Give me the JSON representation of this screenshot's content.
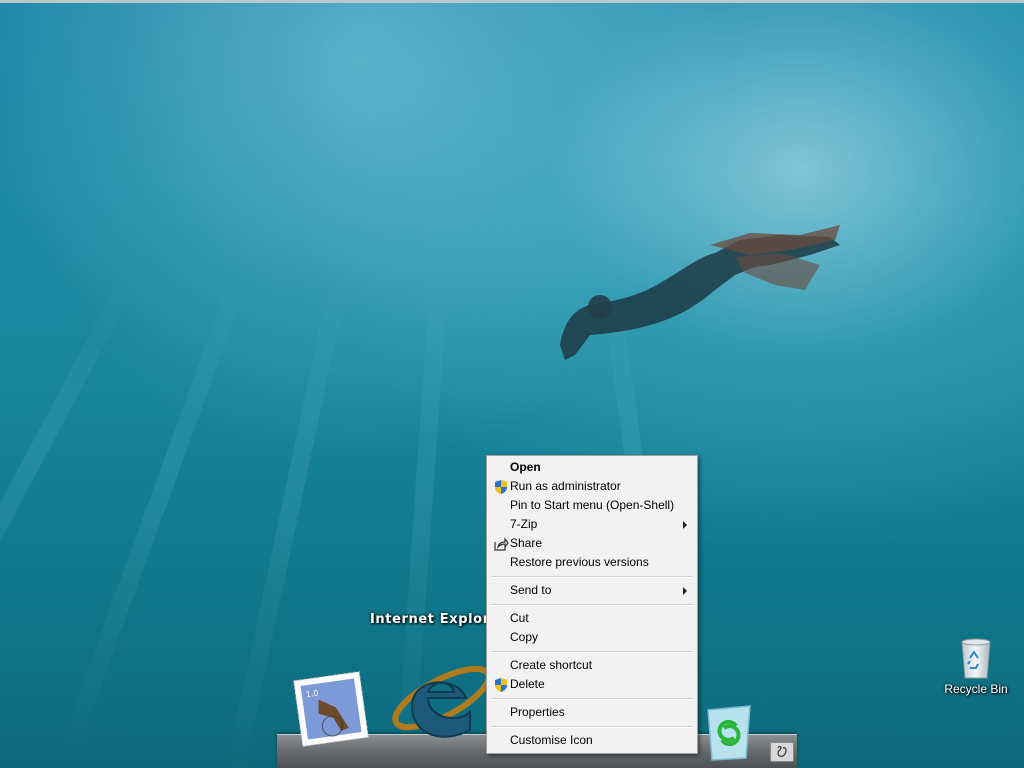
{
  "desktop": {
    "icons": [
      {
        "label": "Recycle Bin",
        "icon": "recycle-bin-icon"
      }
    ]
  },
  "dock": {
    "tooltip": "Internet Explorer",
    "items": [
      {
        "icon": "mail-stamp-icon",
        "stamp_text": "1.0"
      },
      {
        "icon": "internet-explorer-icon"
      },
      {
        "icon": "trash-icon"
      },
      {
        "icon": "finder-icon"
      }
    ]
  },
  "context_menu": {
    "items": [
      {
        "label": "Open",
        "bold": true
      },
      {
        "label": "Run as administrator",
        "icon": "uac-shield-icon"
      },
      {
        "label": "Pin to Start menu (Open-Shell)"
      },
      {
        "label": "7-Zip",
        "submenu": true
      },
      {
        "label": "Share",
        "icon": "share-icon"
      },
      {
        "label": "Restore previous versions"
      },
      {
        "label": "Send to",
        "submenu": true
      },
      {
        "label": "Cut"
      },
      {
        "label": "Copy"
      },
      {
        "label": "Create shortcut"
      },
      {
        "label": "Delete",
        "icon": "uac-shield-icon"
      },
      {
        "label": "Properties"
      },
      {
        "label": "Customise Icon"
      }
    ]
  }
}
